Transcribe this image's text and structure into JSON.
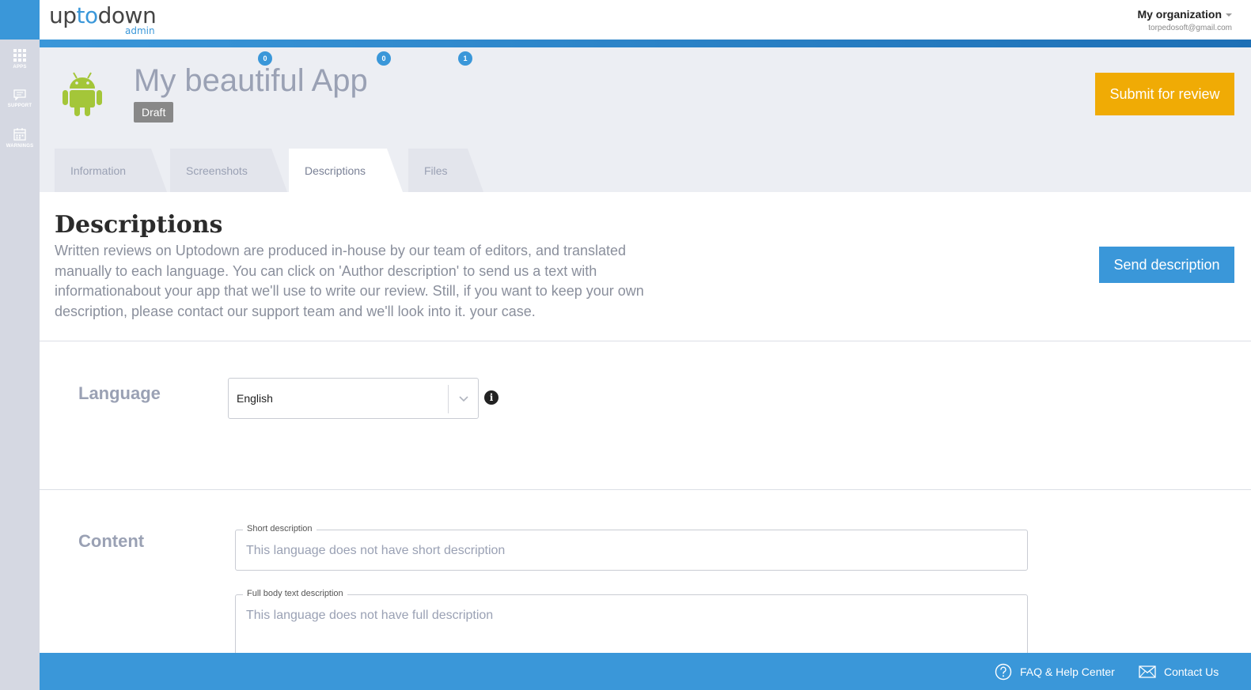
{
  "sidebar": {
    "items": [
      {
        "label": "APPS",
        "icon": "grid-icon"
      },
      {
        "label": "SUPPORT",
        "icon": "chat-icon"
      },
      {
        "label": "WARNINGS",
        "icon": "calendar-icon"
      }
    ]
  },
  "header": {
    "logo_main_a": "up",
    "logo_main_b": "to",
    "logo_main_c": "down",
    "logo_sub": "admin",
    "org_name": "My organization",
    "org_email": "torpedosoft@gmail.com"
  },
  "app": {
    "title": "My beautiful App",
    "status": "Draft",
    "submit_label": "Submit for review"
  },
  "tabs": [
    {
      "label": "Information"
    },
    {
      "label": "Screenshots",
      "badge": "0"
    },
    {
      "label": "Descriptions",
      "badge": "0"
    },
    {
      "label": "Files",
      "badge": "1"
    }
  ],
  "descriptions": {
    "title": "Descriptions",
    "text": "Written reviews on Uptodown are produced in-house by our team of editors, and translated manually to each language. You can click on 'Author description' to send us a text with informationabout your app that we'll use to write our review. Still, if you want to keep your own description, please contact our support team and we'll look into it. your case.",
    "send_label": "Send description"
  },
  "language": {
    "label": "Language",
    "selected": "English"
  },
  "content": {
    "label": "Content",
    "short_legend": "Short description",
    "short_placeholder": "This language does not have short description",
    "full_legend": "Full body text description",
    "full_placeholder": "This language does not have full description"
  },
  "footer": {
    "faq_label": "FAQ & Help Center",
    "contact_label": "Contact Us"
  },
  "colors": {
    "accent": "#3a97d9",
    "submit": "#f0ab05",
    "android": "#a4c639"
  }
}
